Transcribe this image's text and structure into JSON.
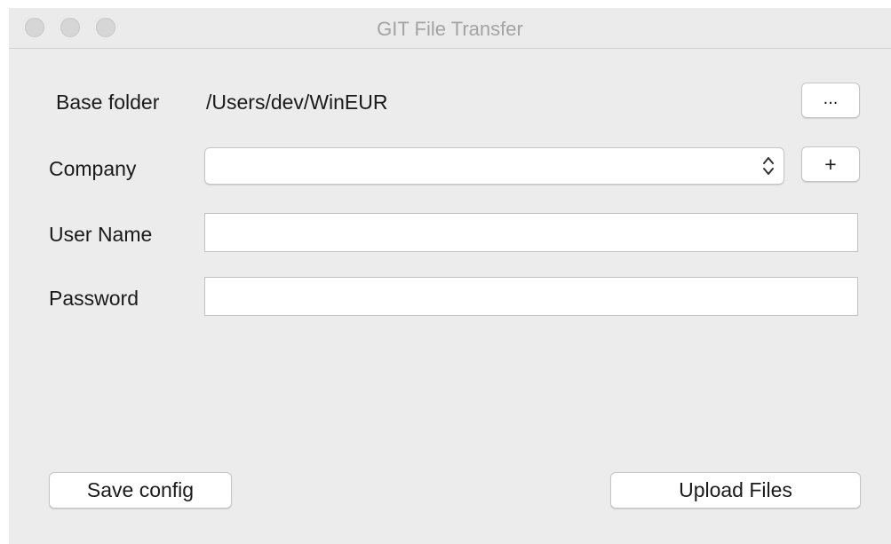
{
  "window": {
    "title": "GIT File Transfer"
  },
  "form": {
    "base_folder_label": "Base folder",
    "base_folder_value": "/Users/dev/WinEUR",
    "browse_button_label": "...",
    "company_label": "Company",
    "company_selected": "",
    "add_company_button_label": "+",
    "username_label": "User Name",
    "username_value": "",
    "password_label": "Password",
    "password_value": ""
  },
  "actions": {
    "save_config_label": "Save config",
    "upload_files_label": "Upload Files"
  },
  "icons": {
    "combo_arrow": "updown-chevron-icon",
    "window_controls": [
      "close-icon",
      "minimize-icon",
      "zoom-icon"
    ]
  },
  "colors": {
    "window_bg": "#ececec",
    "title_text": "#a3a3a3",
    "traffic_inactive": "#d6d6d6"
  }
}
